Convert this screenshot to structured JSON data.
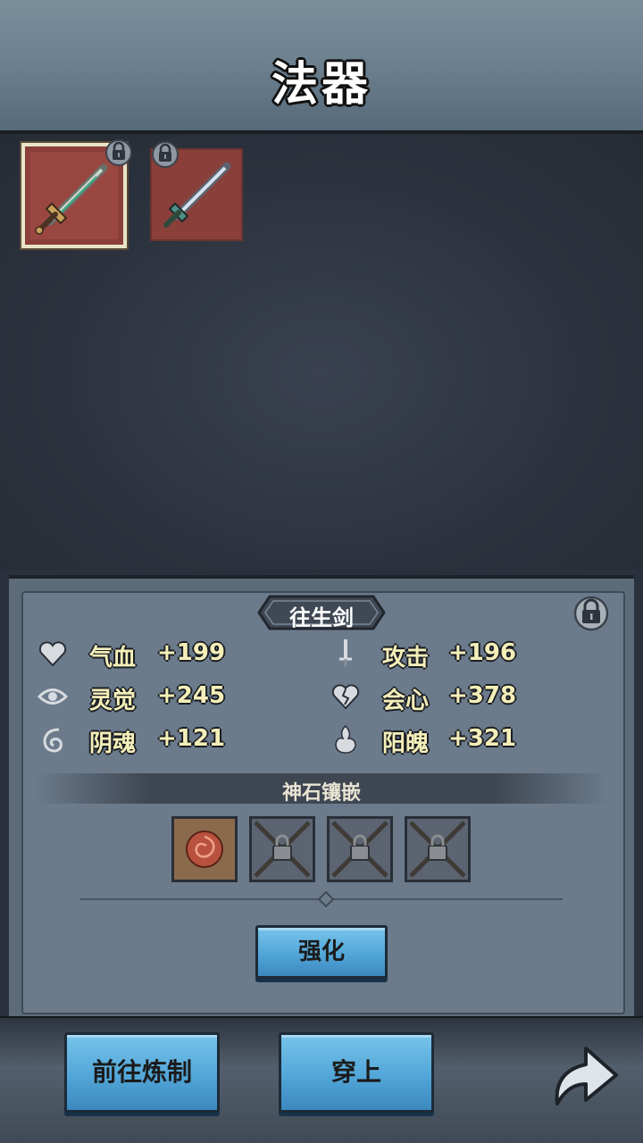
{
  "header": {
    "title": "法器"
  },
  "inventory": {
    "slots": [
      {
        "icon": "ornate-sword-icon",
        "selected": true,
        "locked": true
      },
      {
        "icon": "sword-icon",
        "selected": false,
        "locked": true
      }
    ]
  },
  "detail": {
    "item_name": "往生剑",
    "stats": [
      {
        "icon": "heart-icon",
        "label": "气血",
        "value": "+199"
      },
      {
        "icon": "dagger-icon",
        "label": "攻击",
        "value": "+196"
      },
      {
        "icon": "eye-icon",
        "label": "灵觉",
        "value": "+245"
      },
      {
        "icon": "broken-heart-icon",
        "label": "会心",
        "value": "+378"
      },
      {
        "icon": "swirl-icon",
        "label": "阴魂",
        "value": "+121"
      },
      {
        "icon": "flame-icon",
        "label": "阳魄",
        "value": "+321"
      }
    ],
    "gem_section_title": "神石镶嵌",
    "gem_slots": [
      {
        "state": "filled",
        "icon": "red-gem-icon"
      },
      {
        "state": "locked",
        "icon": "chain-lock-icon"
      },
      {
        "state": "locked",
        "icon": "chain-lock-icon"
      },
      {
        "state": "locked",
        "icon": "chain-lock-icon"
      }
    ],
    "enhance_label": "强化"
  },
  "footer": {
    "refine_label": "前往炼制",
    "equip_label": "穿上",
    "back_icon": "back-arrow-icon"
  },
  "colors": {
    "button_blue": "#52a6d8",
    "stat_text": "#f4efb9",
    "slot_red": "#8a3f3b"
  }
}
